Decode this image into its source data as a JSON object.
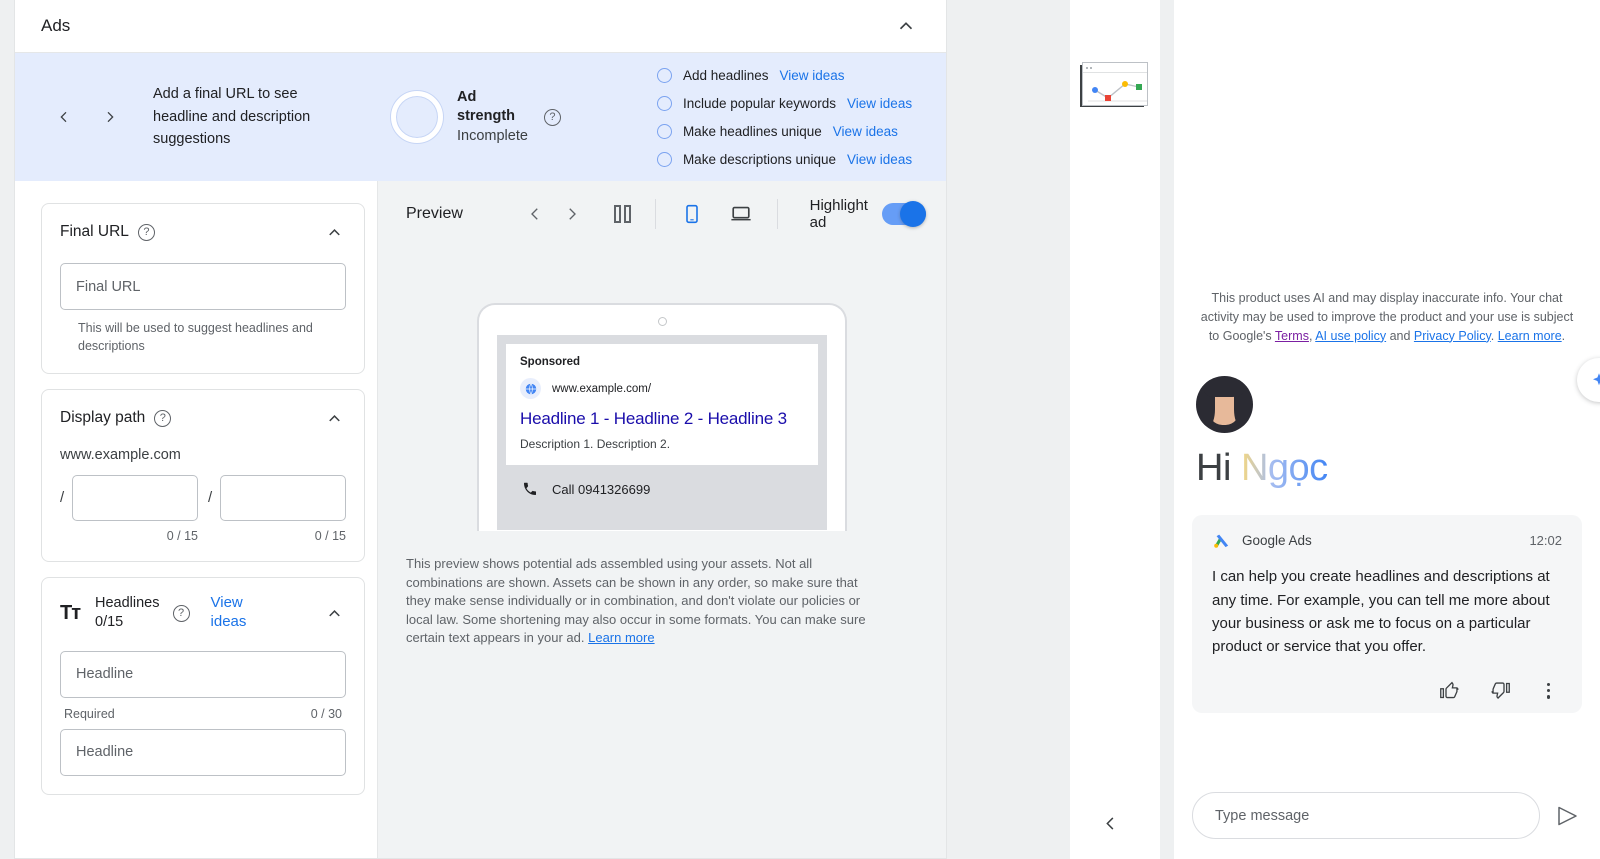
{
  "ads_panel": {
    "title": "Ads",
    "collapse_icon": "chevron-up-icon",
    "strength_banner": {
      "prev_icon": "chevron-left-icon",
      "next_icon": "chevron-right-icon",
      "message": "Add a final URL to see headline and description suggestions",
      "strength_title": "Ad strength",
      "strength_state": "Incomplete",
      "help_icon": "help-circle-icon",
      "suggestions": [
        {
          "label": "Add headlines",
          "link": "View ideas"
        },
        {
          "label": "Include popular keywords",
          "link": "View ideas"
        },
        {
          "label": "Make headlines unique",
          "link": "View ideas"
        },
        {
          "label": "Make descriptions unique",
          "link": "View ideas"
        }
      ]
    }
  },
  "form": {
    "final_url": {
      "title": "Final URL",
      "help_icon": "help-circle-icon",
      "collapse_icon": "chevron-up-icon",
      "placeholder": "Final URL",
      "value": "",
      "hint": "This will be used to suggest headlines and descriptions"
    },
    "display_path": {
      "title": "Display path",
      "help_icon": "help-circle-icon",
      "collapse_icon": "chevron-up-icon",
      "host": "www.example.com",
      "slash": "/",
      "path1_value": "",
      "path1_count": "0 / 15",
      "path2_value": "",
      "path2_count": "0 / 15"
    },
    "headlines": {
      "icon": "text-format-icon",
      "icon_glyph": "Tт",
      "title": "Headlines",
      "count": "0/15",
      "help_icon": "help-circle-icon",
      "view_ideas": "View ideas",
      "collapse_icon": "chevron-up-icon",
      "rows": [
        {
          "placeholder": "Headline",
          "value": "",
          "required": "Required",
          "count": "0 / 30"
        },
        {
          "placeholder": "Headline",
          "value": ""
        }
      ]
    }
  },
  "preview": {
    "label": "Preview",
    "prev_icon": "chevron-left-icon",
    "next_icon": "chevron-right-icon",
    "split_icon": "split-view-icon",
    "mobile_icon": "mobile-icon",
    "desktop_icon": "desktop-icon",
    "highlight_label": "Highlight ad",
    "highlight_on": true,
    "ad": {
      "sponsored": "Sponsored",
      "globe_icon": "globe-icon",
      "url": "www.example.com/",
      "headline": "Headline 1 - Headline 2 - Headline 3",
      "description": "Description 1. Description 2.",
      "phone_icon": "phone-icon",
      "call": "Call 0941326699"
    },
    "disclaimer": "This preview shows potential ads assembled using your assets. Not all combinations are shown. Assets can be shown in any order, so make sure that they make sense individually or in combination, and don't violate our policies or local law. Some shortening may also occur in some formats. You can make sure certain text appears in your ad. ",
    "disclaimer_link": "Learn more"
  },
  "mid_strip": {
    "thumbnail_icon": "chart-thumbnail-icon",
    "collapse_icon": "chevron-left-icon"
  },
  "chat": {
    "ai_note_part1": "This product uses AI and may display inaccurate info. Your chat activity may be used to improve the product and your use is subject to Google's ",
    "terms_link": "Terms",
    "ai_policy_link": "AI use policy",
    "and_text": " and ",
    "privacy_link": "Privacy Policy",
    "learn_more_link": "Learn more",
    "avatar_icon": "user-avatar",
    "greeting_hi": "Hi ",
    "greeting_name": "Ngọc",
    "message": {
      "logo_icon": "google-ads-logo-icon",
      "source": "Google Ads",
      "time": "12:02",
      "body": "I can help you create headlines and descriptions at any time. For example, you can tell me more about your business or ask me to focus on a particular product or service that you offer.",
      "thumbs_up_icon": "thumb-up-icon",
      "thumbs_down_icon": "thumb-down-icon",
      "more_icon": "more-vert-icon"
    },
    "composer_placeholder": "Type message",
    "composer_value": "",
    "send_icon": "send-icon",
    "fab_icon": "sparkle-icon"
  },
  "colors": {
    "accent_blue": "#1a73e8",
    "banner_blue": "#e4ecfd",
    "link_visited": "#7b1fa2"
  }
}
